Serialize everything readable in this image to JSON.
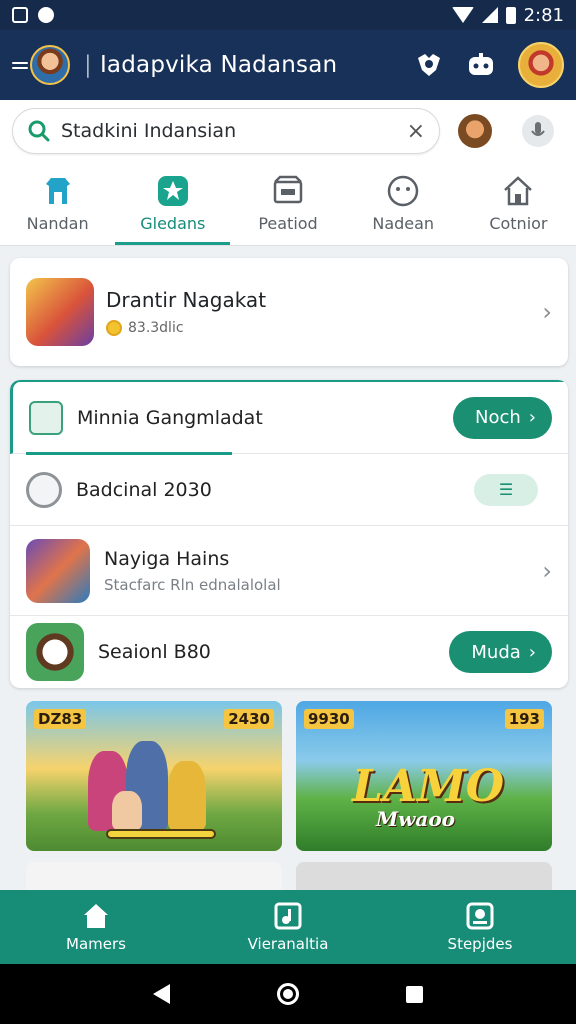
{
  "status_bar": {
    "time": "2:81"
  },
  "app_bar": {
    "title": "Iadapvika Nadansan"
  },
  "search": {
    "value": "Stadkini Indansian",
    "clear_glyph": "×"
  },
  "tabs": [
    {
      "label": "Nandan",
      "icon": "shop-icon"
    },
    {
      "label": "Gledans",
      "icon": "star-badge-icon"
    },
    {
      "label": "Peatiod",
      "icon": "store-icon"
    },
    {
      "label": "Nadean",
      "icon": "face-icon"
    },
    {
      "label": "Cotnior",
      "icon": "home-icon"
    }
  ],
  "featured": {
    "title": "Drantir Nagakat",
    "subtitle": "83.3dlic"
  },
  "list": {
    "row1": {
      "title": "Minnia Gangmladat",
      "button": "Noch"
    },
    "row2": {
      "title": "Badcinal 2030",
      "toggle_glyph": "☰"
    },
    "row3": {
      "title": "Nayiga Hains",
      "subtitle": "Stacfarc Rln ednalalolal"
    },
    "row4": {
      "title": "Seaionl B80",
      "button": "Muda"
    }
  },
  "tiles": [
    {
      "badge_left": "DZ83",
      "badge_right": "2430"
    },
    {
      "badge_left": "9930",
      "badge_right": "193",
      "logo": "LAMO",
      "logo_sub": "Mwaoo"
    }
  ],
  "bottom_nav": [
    {
      "label": "Mamers",
      "icon": "home-icon"
    },
    {
      "label": "Vieranaltia",
      "icon": "music-note-icon"
    },
    {
      "label": "Stepjdes",
      "icon": "camera-icon"
    }
  ],
  "colors": {
    "app_bar": "#183158",
    "accent": "#1a8f72",
    "bottom_nav": "#178c76"
  }
}
